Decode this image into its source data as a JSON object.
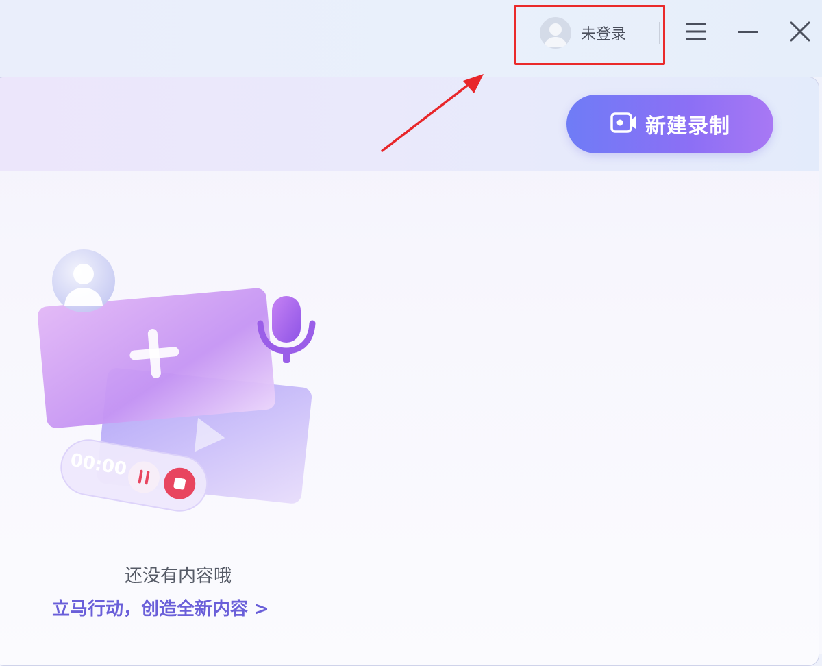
{
  "titlebar": {
    "user_label": "未登录",
    "icons": {
      "avatar": "avatar-icon",
      "menu": "menu-icon",
      "minimize": "minimize-icon",
      "close": "close-icon"
    }
  },
  "header": {
    "new_recording_label": "新建录制",
    "new_recording_icon": "video-camera-icon"
  },
  "empty_state": {
    "title": "还没有内容哦",
    "cta": "立马行动，创造全新内容 >",
    "timer_text": "00:00"
  },
  "colors": {
    "accent": "#7b6ff5",
    "cta_text": "#6a5fd9",
    "highlight": "#ea2a2a",
    "stop_button": "#e8455f"
  }
}
